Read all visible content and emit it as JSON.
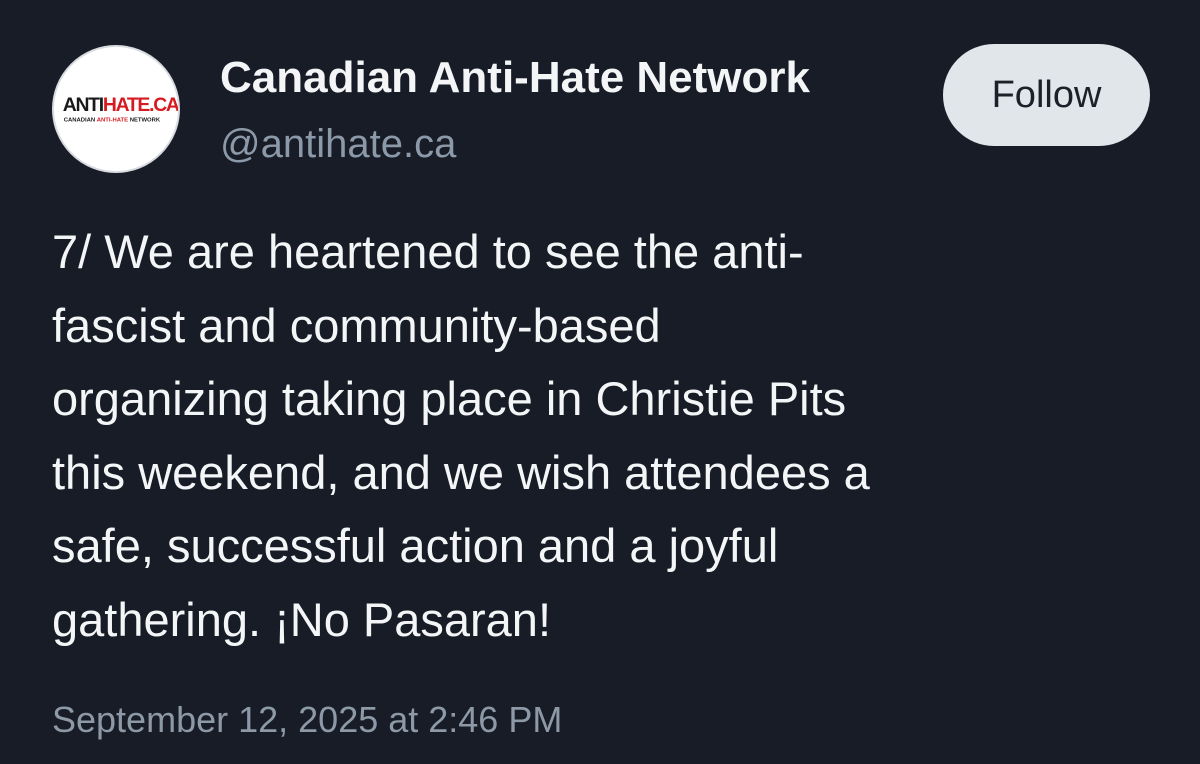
{
  "author": {
    "display_name": "Canadian Anti-Hate Network",
    "handle": "@antihate.ca",
    "avatar": {
      "logo_main_dark": "ANTI",
      "logo_main_red": "HATE.CA",
      "logo_sub_dark_1": "CANADIAN",
      "logo_sub_red": "ANTI-HATE",
      "logo_sub_dark_2": "NETWORK",
      "brand_red": "#d71920",
      "brand_dark": "#1a1a1a"
    }
  },
  "follow_button": {
    "label": "Follow"
  },
  "post": {
    "lines": [
      "7/ We are heartened to see the anti-",
      "fascist and community-based",
      "organizing taking place in Christie Pits",
      "this weekend, and we wish attendees a",
      "safe, successful action and a joyful",
      "gathering. ¡No Pasaran!"
    ],
    "timestamp": "September 12, 2025 at 2:46 PM"
  },
  "colors": {
    "background": "#171c26",
    "text": "#f3f5f7",
    "secondary_text": "#8c99a8",
    "button_background": "#e1e6eb",
    "button_text": "#1c2129"
  }
}
